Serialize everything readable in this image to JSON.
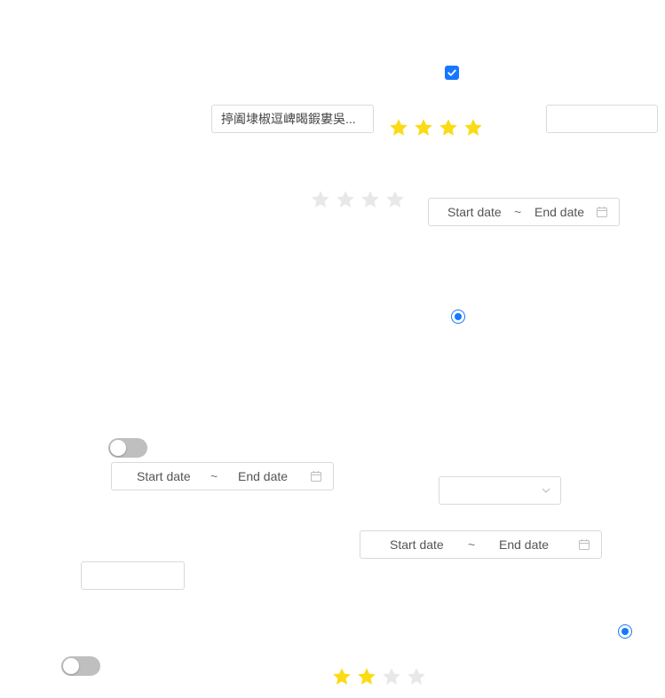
{
  "checkbox": {
    "checked": true
  },
  "text_input_1": {
    "value": "揨阖埭椒逗崥暍鍜婁吳..."
  },
  "text_input_2": {
    "value": ""
  },
  "text_input_3": {
    "value": ""
  },
  "rating_1": {
    "value": 4,
    "max": 4
  },
  "rating_2": {
    "value": 0,
    "max": 4
  },
  "rating_3": {
    "value": 2,
    "max": 4
  },
  "date_range_1": {
    "start_placeholder": "Start date",
    "separator": "~",
    "end_placeholder": "End date"
  },
  "date_range_2": {
    "start_placeholder": "Start date",
    "separator": "~",
    "end_placeholder": "End date"
  },
  "date_range_3": {
    "start_placeholder": "Start date",
    "separator": "~",
    "end_placeholder": "End date"
  },
  "radio_1": {
    "checked": true
  },
  "radio_2": {
    "checked": true
  },
  "switch_1": {
    "on": false
  },
  "switch_2": {
    "on": false
  },
  "select_1": {
    "value": ""
  },
  "colors": {
    "accent": "#1677ff",
    "star_filled": "#fadb14",
    "star_empty": "#e8e8e8",
    "switch_off": "#bfbfbf",
    "border": "#d9d9d9"
  },
  "icons": {
    "calendar": "calendar-icon",
    "chevron": "chevron-down-icon",
    "star": "star-icon",
    "check": "check-icon"
  }
}
